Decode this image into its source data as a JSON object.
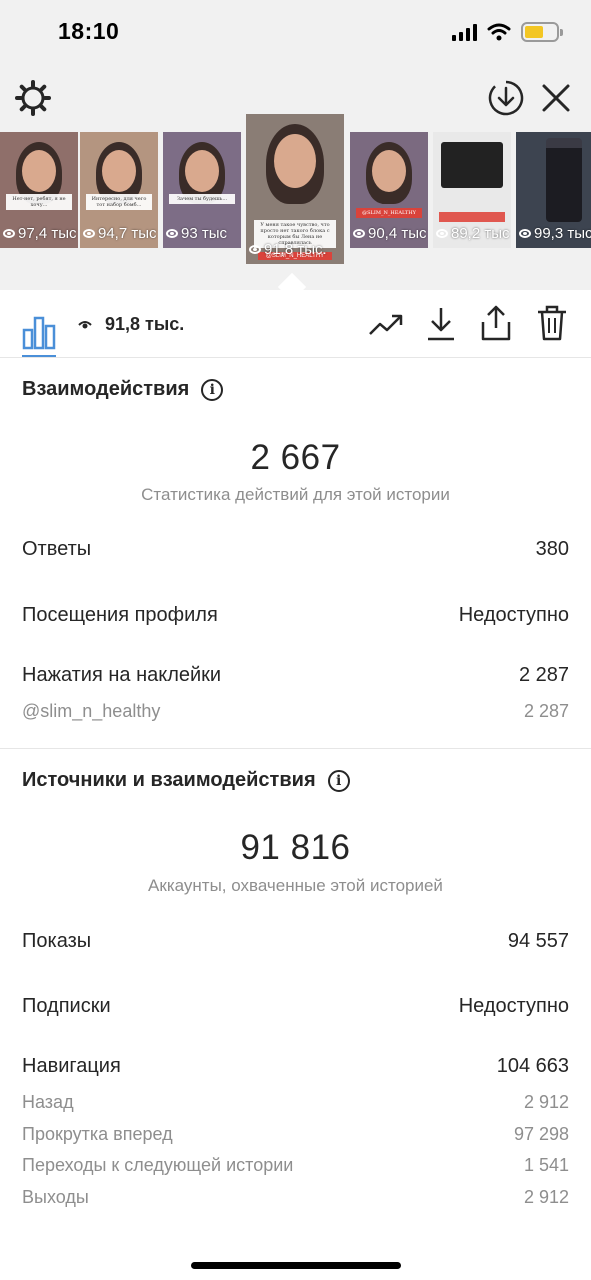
{
  "status_bar": {
    "time": "18:10",
    "battery_level": 0.6,
    "battery_color": "#f3c623"
  },
  "toolbar": {
    "settings_icon": "gear-icon",
    "download_icon": "download-circle-icon",
    "close_icon": "close-icon"
  },
  "stories": [
    {
      "views": "97,4 тыс",
      "bg": "#8f6f6a",
      "text": "Нет-нет, ребят, я не хочу..."
    },
    {
      "views": "94,7 тыс",
      "bg": "#b49580",
      "text": "Интересно, для чего тот набор бомб..."
    },
    {
      "views": "93 тыс",
      "bg": "#7d6d86",
      "text": "Зачем ты будешь..."
    },
    {
      "views": "91,8 тыс.",
      "bg": "#8a7d75",
      "text": "У меня такое чувство, что просто нет такого блока с которым бы Лена не справлялась",
      "caption": "@SLIM_N_HEALTHY",
      "active": true
    },
    {
      "views": "90,4 тыс",
      "bg": "#7b6a80",
      "text": "@SLIM_N_HEALTHY"
    },
    {
      "views": "89,2 тыс",
      "bg": "#e9e9e9",
      "text": "@SLIM_N_HEALTHY"
    },
    {
      "views": "99,3 тыс",
      "bg": "#3d4450",
      "text": ""
    }
  ],
  "action_bar": {
    "views": "91,8 тыс.",
    "icons": [
      "bar-chart-icon",
      "eye-icon",
      "trend-icon",
      "download-icon",
      "share-icon",
      "trash-icon"
    ],
    "accent": "#4a8fd8"
  },
  "interactions": {
    "title": "Взаимодействия",
    "total": "2 667",
    "caption": "Статистика действий для этой истории",
    "rows": [
      {
        "label": "Ответы",
        "value": "380"
      },
      {
        "label": "Посещения профиля",
        "value": "Недоступно"
      },
      {
        "label": "Нажатия на наклейки",
        "value": "2 287"
      }
    ],
    "sub_rows": [
      {
        "label": "@slim_n_healthy",
        "value": "2 287"
      }
    ]
  },
  "discovery": {
    "title": "Источники и взаимодействия",
    "total": "91 816",
    "caption": "Аккаунты, охваченные этой историей",
    "rows": [
      {
        "label": "Показы",
        "value": "94 557"
      },
      {
        "label": "Подписки",
        "value": "Недоступно"
      },
      {
        "label": "Навигация",
        "value": "104 663"
      }
    ],
    "sub_rows": [
      {
        "label": "Назад",
        "value": "2 912"
      },
      {
        "label": "Прокрутка вперед",
        "value": "97 298"
      },
      {
        "label": "Переходы к следующей истории",
        "value": "1 541"
      },
      {
        "label": "Выходы",
        "value": "2 912"
      }
    ]
  }
}
